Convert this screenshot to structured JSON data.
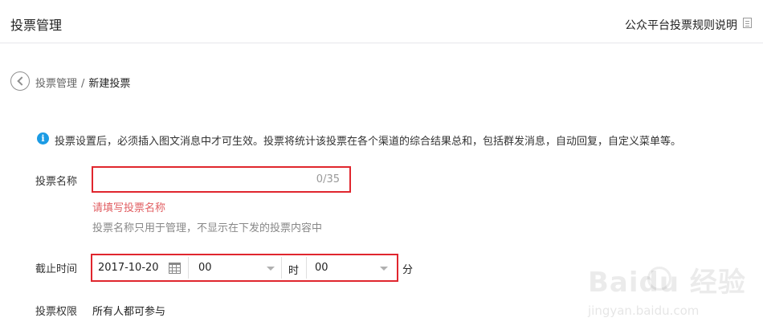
{
  "header": {
    "title": "投票管理",
    "rules_link": "公众平台投票规则说明"
  },
  "breadcrumb": {
    "parent": "投票管理",
    "separator": "/",
    "current": "新建投票"
  },
  "notice": {
    "icon_text": "i",
    "text": "投票设置后，必须插入图文消息中才可生效。投票将统计该投票在各个渠道的综合结果总和，包括群发消息，自动回复，自定义菜单等。"
  },
  "form": {
    "name": {
      "label": "投票名称",
      "value": "",
      "counter": "0/35",
      "error": "请填写投票名称",
      "hint": "投票名称只用于管理，不显示在下发的投票内容中"
    },
    "deadline": {
      "label": "截止时间",
      "date": "2017-10-20",
      "hour": "00",
      "hour_unit": "时",
      "minute": "00",
      "minute_unit": "分"
    },
    "permission": {
      "label": "投票权限",
      "value": "所有人都可参与"
    }
  },
  "watermark": {
    "brand": "Baidu 经验",
    "url": "jingyan.baidu.com"
  },
  "colors": {
    "highlight_border": "#e0262e",
    "error_text": "#e15f63",
    "info_blue": "#1b9be4"
  }
}
